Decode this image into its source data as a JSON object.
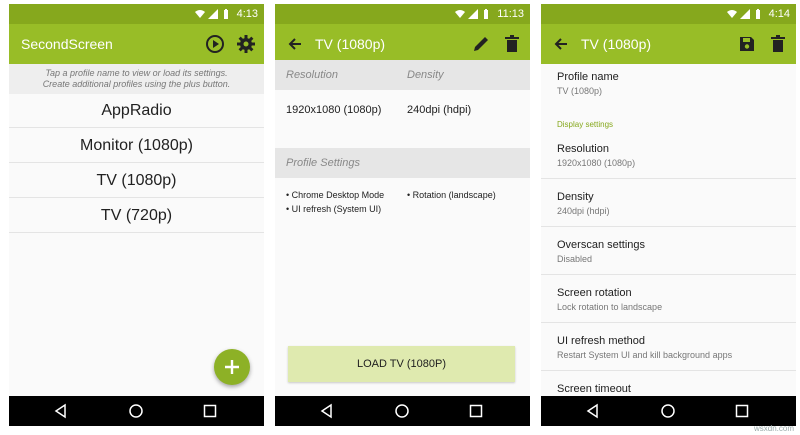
{
  "status": {
    "time1": "4:13",
    "time2": "11:13",
    "time3": "4:14"
  },
  "screen1": {
    "title": "SecondScreen",
    "hint_line1": "Tap a profile name to view or load its settings.",
    "hint_line2": "Create additional profiles using the plus button.",
    "profiles": [
      "AppRadio",
      "Monitor (1080p)",
      "TV (1080p)",
      "TV (720p)"
    ],
    "icons": [
      "play-circle-icon",
      "gear-icon",
      "plus-icon"
    ]
  },
  "screen2": {
    "title": "TV (1080p)",
    "resolution_header": "Resolution",
    "density_header": "Density",
    "resolution_value": "1920x1080 (1080p)",
    "density_value": "240dpi (hdpi)",
    "profile_settings_header": "Profile Settings",
    "settings_col1": [
      "• Chrome Desktop Mode",
      "• UI refresh (System UI)"
    ],
    "settings_col2": [
      "• Rotation (landscape)"
    ],
    "load_button": "LOAD TV (1080P)",
    "icons": [
      "back-arrow-icon",
      "pencil-icon",
      "trash-icon"
    ]
  },
  "screen3": {
    "title": "TV (1080p)",
    "profile_name_label": "Profile name",
    "profile_name_value": "TV (1080p)",
    "category": "Display settings",
    "settings": [
      {
        "title": "Resolution",
        "summary": "1920x1080 (1080p)"
      },
      {
        "title": "Density",
        "summary": "240dpi (hdpi)"
      },
      {
        "title": "Overscan settings",
        "summary": "Disabled"
      },
      {
        "title": "Screen rotation",
        "summary": "Lock rotation to landscape"
      },
      {
        "title": "UI refresh method",
        "summary": "Restart System UI and kill background apps"
      },
      {
        "title": "Screen timeout",
        "summary": ""
      }
    ],
    "icons": [
      "back-arrow-icon",
      "save-icon",
      "trash-icon"
    ]
  },
  "watermark": "wsxdn.com",
  "colors": {
    "statusbar": "#86a81d",
    "appbar": "#98bd27",
    "fab": "#8db126",
    "load_button": "#dfeaaf"
  }
}
